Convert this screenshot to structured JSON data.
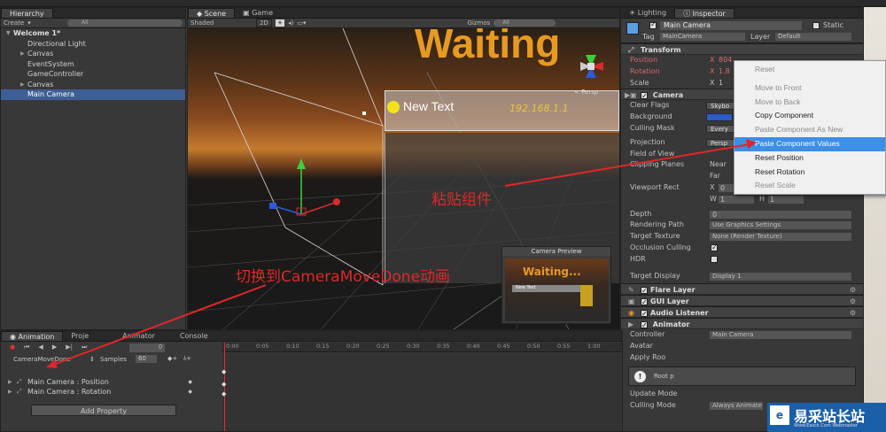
{
  "hierarchy": {
    "tab": "Hierarchy",
    "create_label": "Create",
    "search_placeholder": "All",
    "scene_name": "Welcome 1*",
    "items": [
      {
        "label": "Directional Light",
        "arrow": ""
      },
      {
        "label": "Canvas",
        "arrow": "▶"
      },
      {
        "label": "EventSystem",
        "arrow": ""
      },
      {
        "label": "GameController",
        "arrow": ""
      },
      {
        "label": "Canvas",
        "arrow": "▶"
      },
      {
        "label": "Main Camera",
        "arrow": ""
      }
    ]
  },
  "scene": {
    "tabs": [
      "Scene",
      "Game"
    ],
    "shading": "Shaded",
    "mode_2d": "2D",
    "gizmos": "Gizmos",
    "search": "All",
    "persp_label": "< Persp",
    "ui_text": "New Text",
    "ip_text": "192.168.1.1",
    "waiting_text": "Waiting",
    "preview_title": "Camera Preview",
    "preview_waiting": "Waiting...",
    "preview_new_text": "New Text"
  },
  "inspector": {
    "tabs": [
      "Lighting",
      "Inspector"
    ],
    "object_name": "Main Camera",
    "static_label": "Static",
    "tag_label": "Tag",
    "tag_value": "MainCamera",
    "layer_label": "Layer",
    "layer_value": "Default",
    "transform": {
      "title": "Transform",
      "position_label": "Position",
      "position_x": "804",
      "rotation_label": "Rotation",
      "rotation_x": "1.8",
      "scale_label": "Scale",
      "scale_x": "1"
    },
    "camera": {
      "title": "Camera",
      "rows": [
        {
          "label": "Clear Flags",
          "value": "Skybo"
        },
        {
          "label": "Background",
          "value": ""
        },
        {
          "label": "Culling Mask",
          "value": "Every"
        }
      ],
      "projection_label": "Projection",
      "projection_value": "Persp",
      "fov_label": "Field of View",
      "clipping_label": "Clipping Planes",
      "near_label": "Near",
      "far_label": "Far",
      "viewport_label": "Viewport Rect",
      "vx": "0",
      "vy": "0",
      "vw": "1",
      "vh": "1",
      "depth_label": "Depth",
      "depth_value": "0",
      "rendering_label": "Rendering Path",
      "rendering_value": "Use Graphics Settings",
      "target_label": "Target Texture",
      "target_value": "None (Render Texture)",
      "occlusion_label": "Occlusion Culling",
      "hdr_label": "HDR",
      "display_label": "Target Display",
      "display_value": "Display 1"
    },
    "components": [
      "Flare Layer",
      "GUI Layer",
      "Audio Listener"
    ],
    "animator": {
      "title": "Animator",
      "controller_label": "Controller",
      "controller_value": "Main Camera",
      "avatar_label": "Avatar",
      "apply_root_label": "Apply Roo",
      "root_label": "Root p",
      "update_mode_label": "Update Mode",
      "culling_mode_label": "Culling Mode",
      "culling_mode_value": "Always Animate"
    }
  },
  "context_menu": {
    "items": [
      {
        "label": "Reset",
        "state": "disabled"
      },
      {
        "label": "",
        "state": "separator"
      },
      {
        "label": "Move to Front",
        "state": "disabled"
      },
      {
        "label": "Move to Back",
        "state": "disabled"
      },
      {
        "label": "Copy Component",
        "state": "enabled"
      },
      {
        "label": "Paste Component As New",
        "state": "disabled"
      },
      {
        "label": "Paste Component Values",
        "state": "highlighted"
      },
      {
        "label": "Reset Position",
        "state": "enabled"
      },
      {
        "label": "Reset Rotation",
        "state": "enabled"
      },
      {
        "label": "Reset Scale",
        "state": "disabled"
      }
    ]
  },
  "annotations": {
    "paste_note": "粘贴组件",
    "switch_note": "切换到CameraMoveDone动画"
  },
  "animation": {
    "tabs": [
      "Animation",
      "Proje",
      "Animator",
      "Console"
    ],
    "clip_name": "CameraMoveDone",
    "samples_label": "Samples",
    "samples_value": "60",
    "frame_value": "0",
    "ticks": [
      "0:00",
      "0:05",
      "0:10",
      "0:15",
      "0:20",
      "0:25",
      "0:30",
      "0:35",
      "0:40",
      "0:45",
      "0:50",
      "0:55",
      "1:00"
    ],
    "properties": [
      "Main Camera : Position",
      "Main Camera : Rotation"
    ],
    "add_property": "Add Property"
  },
  "watermark": {
    "title": "易采站长站",
    "subtitle": "Www.Easck.Com Webmaster"
  },
  "colors": {
    "selection": "#3e5f96",
    "menu_highlight": "#3d8ee6",
    "annotation": "#e0262a",
    "timeline_cursor": "#d83030"
  }
}
